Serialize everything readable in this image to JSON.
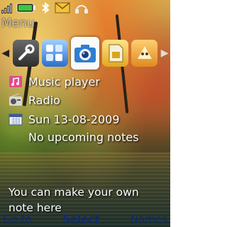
{
  "menu_title": "Menu",
  "status_icons": [
    "signal-icon",
    "battery-icon",
    "bluetooth-icon",
    "message-icon",
    "headset-icon"
  ],
  "main_menu": {
    "icons": [
      "tools-icon",
      "apps-icon",
      "camera-icon",
      "sim-icon",
      "music-icon"
    ],
    "selected": "camera-icon"
  },
  "info": {
    "music_label": "Music player",
    "radio_label": "Radio",
    "date": "Sun 13-08-2009",
    "notes": "No upcoming notes"
  },
  "note_text": "You can make your own note here",
  "softkeys": {
    "left": "Go to",
    "middle": "Select",
    "right": "Names"
  },
  "colors": {
    "battery": "#3cc83c",
    "softkey_text": "#0a2a6a",
    "selected_tile": "#fafafa"
  }
}
